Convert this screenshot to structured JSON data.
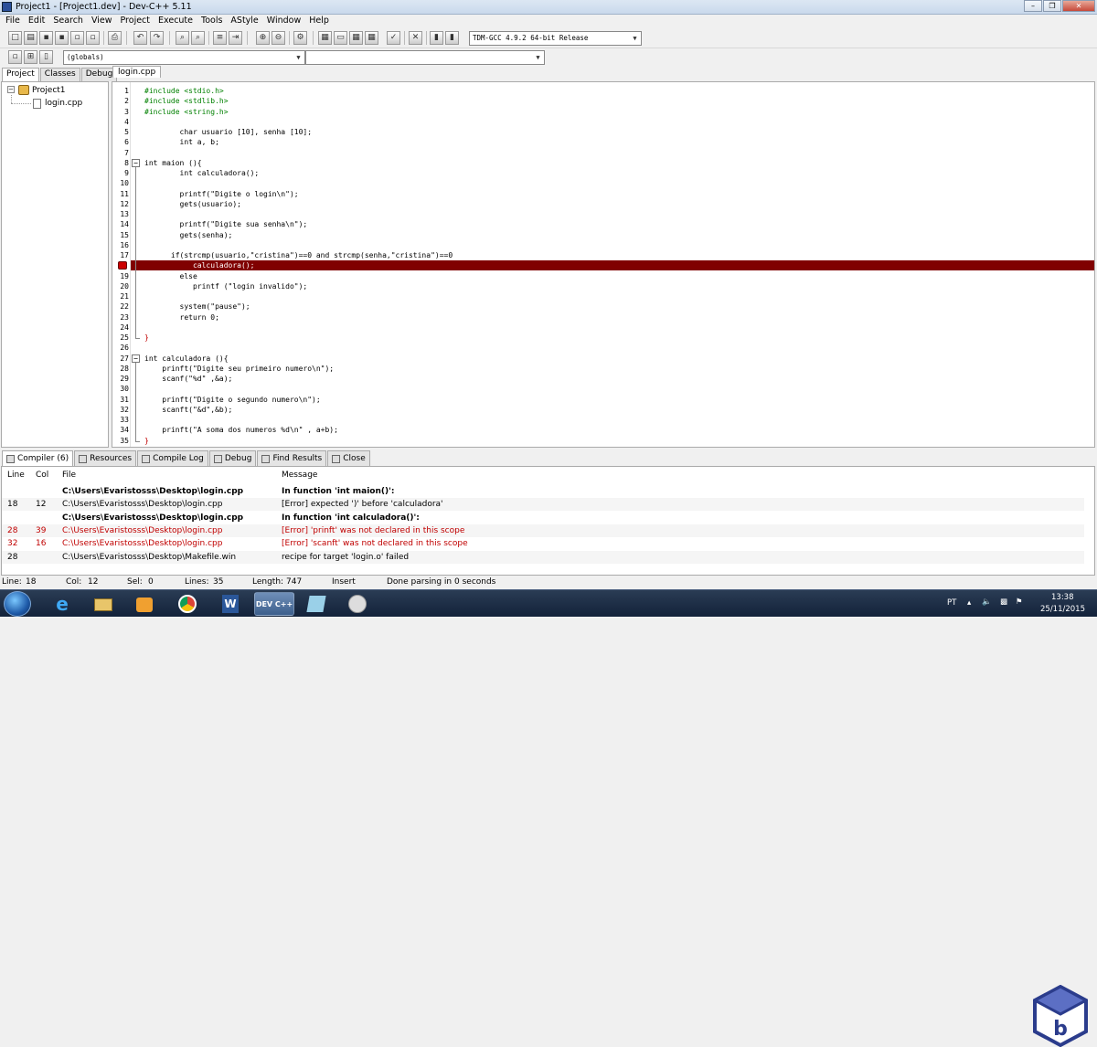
{
  "window": {
    "title": "Project1 - [Project1.dev] - Dev-C++ 5.11"
  },
  "menu": [
    "File",
    "Edit",
    "Search",
    "View",
    "Project",
    "Execute",
    "Tools",
    "AStyle",
    "Window",
    "Help"
  ],
  "toolbar": {
    "compiler_select": "TDM-GCC 4.9.2 64-bit Release",
    "scope_select": "(globals)",
    "member_select": ""
  },
  "left_tabs": [
    "Project",
    "Classes",
    "Debug"
  ],
  "project_tree": {
    "root": "Project1",
    "file": "login.cpp"
  },
  "file_tab": "login.cpp",
  "editor": {
    "highlighted_line": 18,
    "lines": [
      {
        "n": "1",
        "text": "#include <stdio.h>",
        "color": "#008000"
      },
      {
        "n": "2",
        "text": "#include <stdlib.h>",
        "color": "#008000"
      },
      {
        "n": "3",
        "text": "#include <string.h>",
        "color": "#008000"
      },
      {
        "n": "4",
        "text": "",
        "color": "#000"
      },
      {
        "n": "5",
        "text": "        char usuario [10], senha [10];",
        "color": "#000"
      },
      {
        "n": "6",
        "text": "        int a, b;",
        "color": "#000"
      },
      {
        "n": "7",
        "text": "",
        "color": "#000"
      },
      {
        "n": "8",
        "text": "int maion (){",
        "color": "#000"
      },
      {
        "n": "9",
        "text": "        int calculadora();",
        "color": "#000"
      },
      {
        "n": "10",
        "text": "",
        "color": "#000"
      },
      {
        "n": "11",
        "text": "        printf(\"Digite o login\\n\");",
        "color": "#000"
      },
      {
        "n": "12",
        "text": "        gets(usuario);",
        "color": "#000"
      },
      {
        "n": "13",
        "text": "",
        "color": "#000"
      },
      {
        "n": "14",
        "text": "        printf(\"Digite sua senha\\n\");",
        "color": "#000"
      },
      {
        "n": "15",
        "text": "        gets(senha);",
        "color": "#000"
      },
      {
        "n": "16",
        "text": "",
        "color": "#000"
      },
      {
        "n": "17",
        "text": "      if(strcmp(usuario,\"cristina\")==0 and strcmp(senha,\"cristina\")==0",
        "color": "#000"
      },
      {
        "n": "18",
        "text": "           calculadora();",
        "color": "#ffffff"
      },
      {
        "n": "19",
        "text": "        else",
        "color": "#000"
      },
      {
        "n": "20",
        "text": "           printf (\"login invalido\");",
        "color": "#000"
      },
      {
        "n": "21",
        "text": "",
        "color": "#000"
      },
      {
        "n": "22",
        "text": "        system(\"pause\");",
        "color": "#000"
      },
      {
        "n": "23",
        "text": "        return 0;",
        "color": "#000"
      },
      {
        "n": "24",
        "text": "",
        "color": "#000"
      },
      {
        "n": "25",
        "text": "}",
        "color": "#c00000"
      },
      {
        "n": "26",
        "text": "",
        "color": "#000"
      },
      {
        "n": "27",
        "text": "int calculadora (){",
        "color": "#000"
      },
      {
        "n": "28",
        "text": "    prinft(\"Digite seu primeiro numero\\n\");",
        "color": "#000"
      },
      {
        "n": "29",
        "text": "    scanf(\"%d\" ,&a);",
        "color": "#000"
      },
      {
        "n": "30",
        "text": "",
        "color": "#000"
      },
      {
        "n": "31",
        "text": "    prinft(\"Digite o segundo numero\\n\");",
        "color": "#000"
      },
      {
        "n": "32",
        "text": "    scanft(\"&d\",&b);",
        "color": "#000"
      },
      {
        "n": "33",
        "text": "",
        "color": "#000"
      },
      {
        "n": "34",
        "text": "    prinft(\"A soma dos numeros %d\\n\" , a+b);",
        "color": "#000"
      },
      {
        "n": "35",
        "text": "}",
        "color": "#c00000"
      }
    ]
  },
  "bottom_tabs": [
    "Compiler (6)",
    "Resources",
    "Compile Log",
    "Debug",
    "Find Results",
    "Close"
  ],
  "messages": {
    "headers": {
      "line": "Line",
      "col": "Col",
      "file": "File",
      "message": "Message"
    },
    "rows": [
      {
        "line": "",
        "col": "",
        "file": "C:\\Users\\Evaristosss\\Desktop\\login.cpp",
        "message": "In function 'int maion()':",
        "style": "bold"
      },
      {
        "line": "18",
        "col": "12",
        "file": "C:\\Users\\Evaristosss\\Desktop\\login.cpp",
        "message": "[Error] expected ')' before 'calculadora'",
        "style": "normal"
      },
      {
        "line": "",
        "col": "",
        "file": "C:\\Users\\Evaristosss\\Desktop\\login.cpp",
        "message": "In function 'int calculadora()':",
        "style": "bold"
      },
      {
        "line": "28",
        "col": "39",
        "file": "C:\\Users\\Evaristosss\\Desktop\\login.cpp",
        "message": "[Error] 'prinft' was not declared in this scope",
        "style": "red"
      },
      {
        "line": "32",
        "col": "16",
        "file": "C:\\Users\\Evaristosss\\Desktop\\login.cpp",
        "message": "[Error] 'scanft' was not declared in this scope",
        "style": "red"
      },
      {
        "line": "28",
        "col": "",
        "file": "C:\\Users\\Evaristosss\\Desktop\\Makefile.win",
        "message": "recipe for target 'login.o' failed",
        "style": "normal"
      }
    ]
  },
  "status": {
    "line_label": "Line:",
    "line": "18",
    "col_label": "Col:",
    "col": "12",
    "sel_label": "Sel:",
    "sel": "0",
    "lines_label": "Lines:",
    "lines": "35",
    "length_label": "Length:",
    "length": "747",
    "mode": "Insert",
    "message": "Done parsing in 0 seconds"
  },
  "taskbar": {
    "lang": "PT",
    "time": "13:38",
    "date": "25/11/2015",
    "devcpp_label": "DEV C++"
  },
  "colors": {
    "highlight": "#800000",
    "error": "#c00000",
    "preprocessor": "#008000",
    "string": "#000080"
  }
}
